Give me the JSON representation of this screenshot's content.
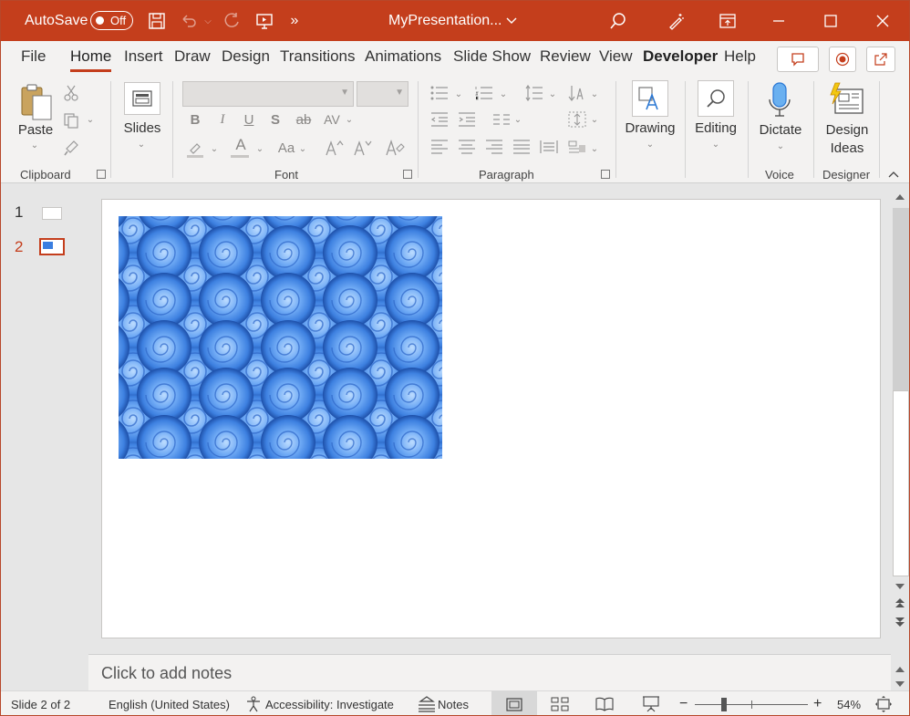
{
  "titlebar": {
    "autosave_label": "AutoSave",
    "autosave_state": "Off",
    "document_title": "MyPresentation...",
    "accent_color": "#c43e1c"
  },
  "menu": {
    "items": [
      "File",
      "Home",
      "Insert",
      "Draw",
      "Design",
      "Transitions",
      "Animations",
      "Slide Show",
      "Review",
      "View",
      "Developer",
      "Help"
    ],
    "active": "Home"
  },
  "ribbon": {
    "clipboard": {
      "paste_label": "Paste",
      "group_label": "Clipboard"
    },
    "slides": {
      "slides_label": "Slides"
    },
    "font": {
      "group_label": "Font",
      "bold": "B",
      "italic": "I",
      "underline": "U",
      "shadow": "S",
      "strikethrough": "ab",
      "spacing": "AV",
      "font_color": "A",
      "change_case": "Aa"
    },
    "paragraph": {
      "group_label": "Paragraph"
    },
    "drawing": {
      "label": "Drawing"
    },
    "editing": {
      "label": "Editing"
    },
    "voice": {
      "dictate_label": "Dictate",
      "group_label": "Voice"
    },
    "designer": {
      "label_line1": "Design",
      "label_line2": "Ideas",
      "group_label": "Designer"
    }
  },
  "thumbnails": {
    "items": [
      {
        "number": "1",
        "selected": false
      },
      {
        "number": "2",
        "selected": true
      }
    ]
  },
  "notes": {
    "placeholder": "Click to add notes"
  },
  "statusbar": {
    "slide_info": "Slide 2 of 2",
    "language": "English (United States)",
    "accessibility": "Accessibility: Investigate",
    "notes_label": "Notes",
    "zoom_percent": "54%"
  }
}
